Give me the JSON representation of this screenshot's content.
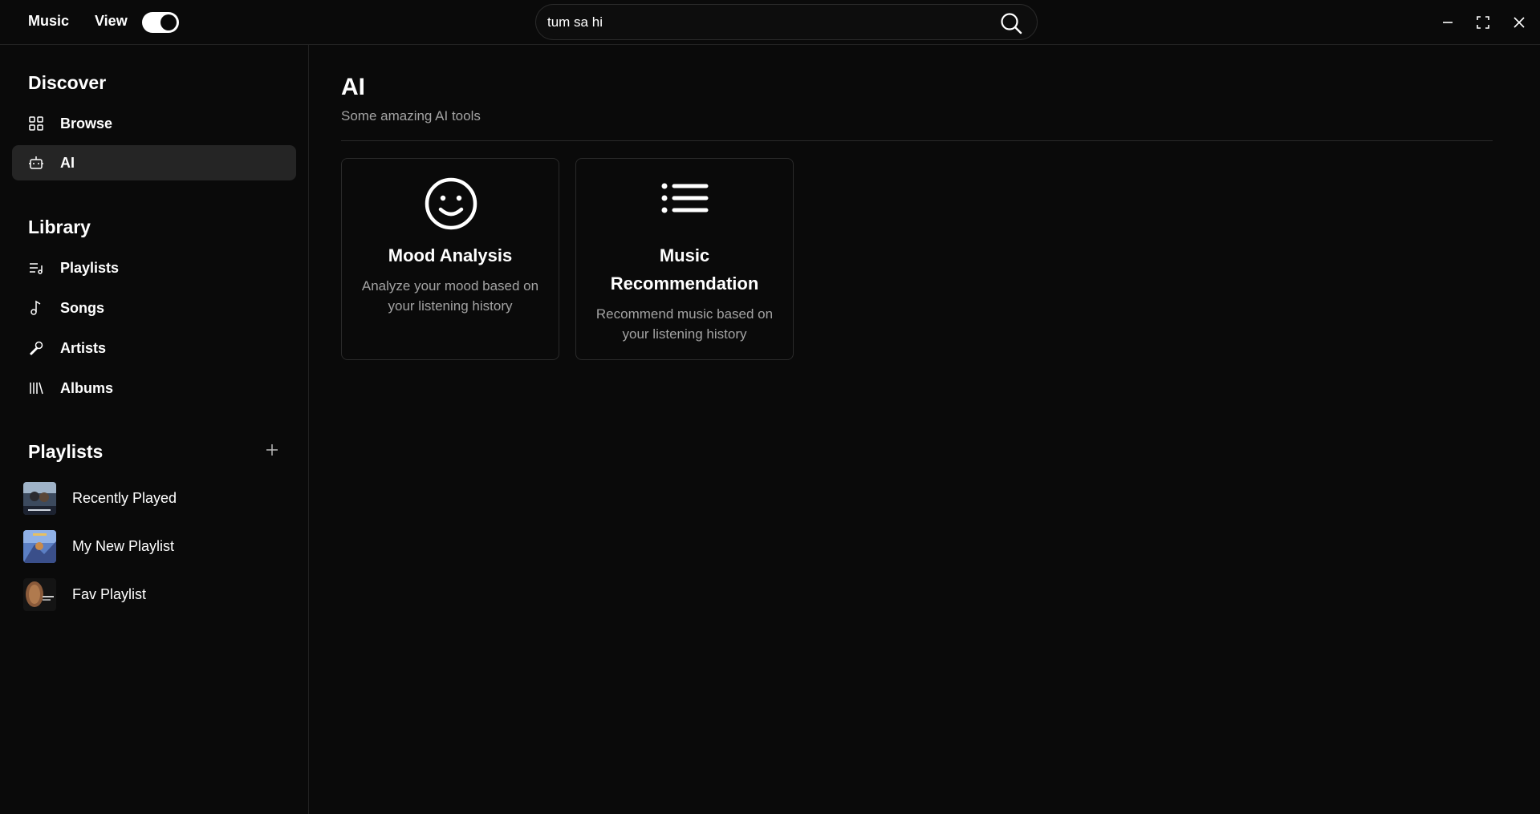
{
  "topbar": {
    "menu_music": "Music",
    "menu_view": "View",
    "toggle_on": true,
    "search_value": "tum sa hi",
    "icons": {
      "search": "search-icon",
      "minimize": "minimize-icon",
      "maximize": "maximize-icon",
      "close": "close-icon"
    }
  },
  "sidebar": {
    "discover_title": "Discover",
    "discover_items": [
      {
        "label": "Browse",
        "icon": "grid-icon"
      },
      {
        "label": "AI",
        "icon": "robot-icon",
        "active": true
      }
    ],
    "library_title": "Library",
    "library_items": [
      {
        "label": "Playlists",
        "icon": "playlist-icon"
      },
      {
        "label": "Songs",
        "icon": "music-note-icon"
      },
      {
        "label": "Artists",
        "icon": "microphone-icon"
      },
      {
        "label": "Albums",
        "icon": "library-icon"
      }
    ],
    "playlists_title": "Playlists",
    "playlists": [
      {
        "label": "Recently Played"
      },
      {
        "label": "My New Playlist"
      },
      {
        "label": "Fav Playlist"
      }
    ]
  },
  "main": {
    "title": "AI",
    "subtitle": "Some amazing AI tools",
    "cards": [
      {
        "title": "Mood Analysis",
        "description": "Analyze your mood based on your listening history",
        "icon": "smiley-icon"
      },
      {
        "title": "Music Recommendation",
        "description": "Recommend music based on your listening history",
        "icon": "list-icon"
      }
    ]
  },
  "colors": {
    "background": "#0a0a0a",
    "active_item": "#252525",
    "muted_text": "#a3a3a3",
    "border": "#2a2a2a"
  }
}
